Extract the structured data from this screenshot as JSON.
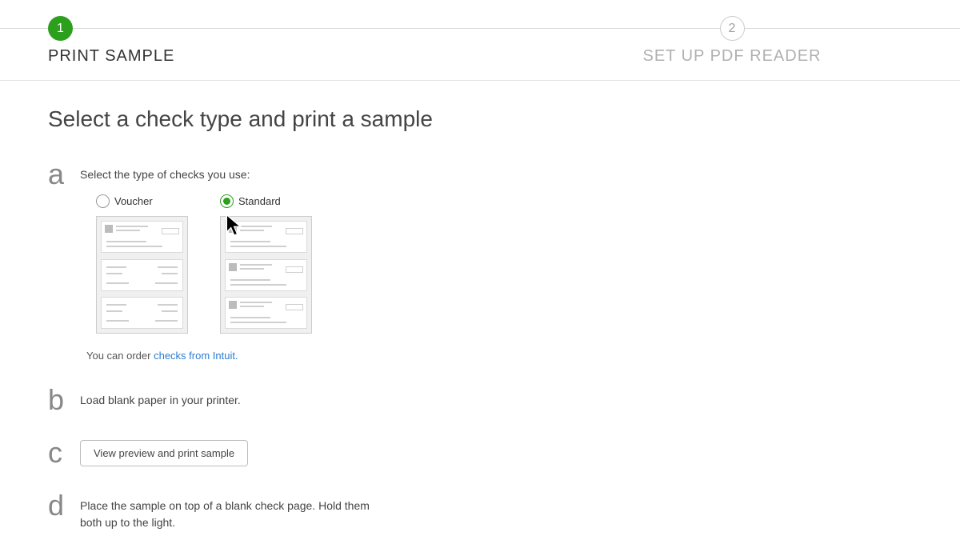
{
  "stepper": {
    "steps": [
      {
        "number": "1",
        "label": "PRINT SAMPLE",
        "active": true
      },
      {
        "number": "2",
        "label": "SET UP PDF READER",
        "active": false
      }
    ]
  },
  "page": {
    "title": "Select a check type and print a sample"
  },
  "step_a": {
    "letter": "a",
    "prompt": "Select the type of checks you use:",
    "option_voucher": "Voucher",
    "option_standard": "Standard",
    "order_prefix": "You can order ",
    "order_link": "checks from Intuit."
  },
  "step_b": {
    "letter": "b",
    "text": "Load blank paper in your printer."
  },
  "step_c": {
    "letter": "c",
    "button": "View preview and print sample"
  },
  "step_d": {
    "letter": "d",
    "text": "Place the sample on top of a blank check page. Hold them both up to the light."
  }
}
